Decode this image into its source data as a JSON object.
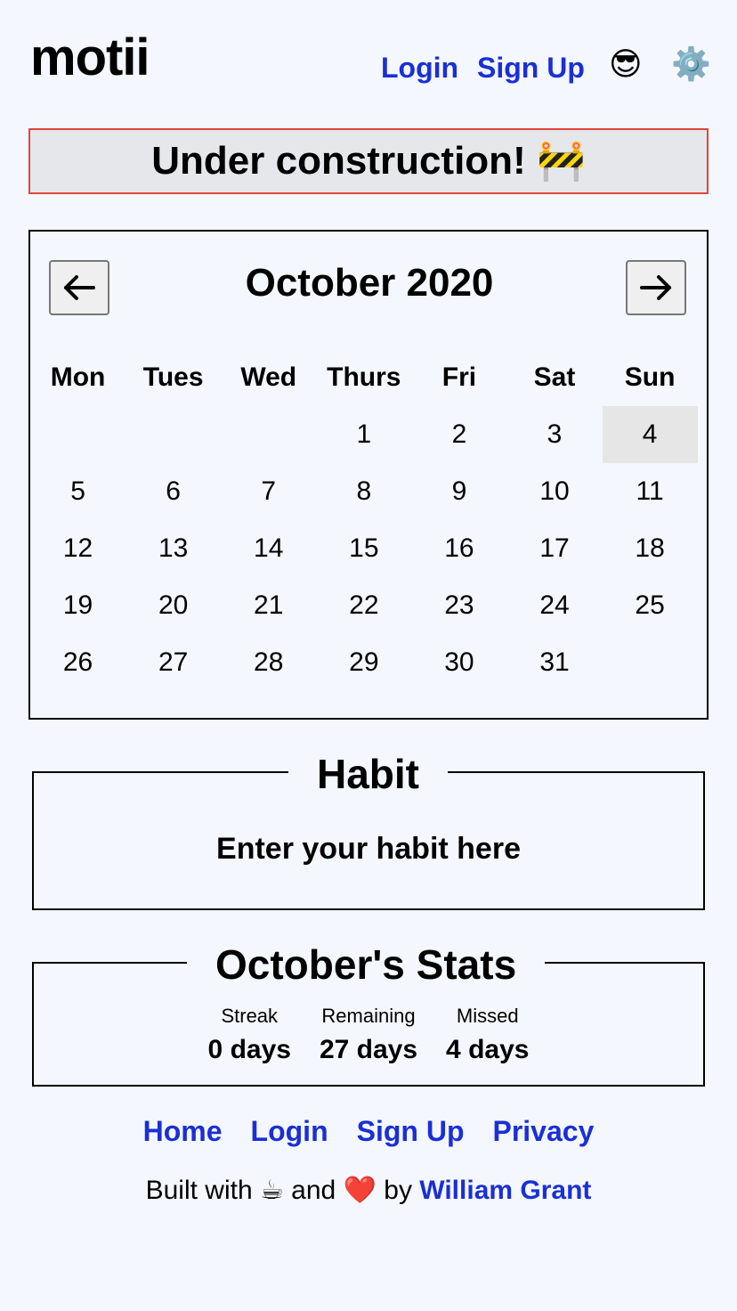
{
  "header": {
    "logo": "motii",
    "login_label": "Login",
    "signup_label": "Sign Up",
    "profile_emoji": "😎",
    "settings_emoji": "⚙️"
  },
  "banner": {
    "text": "Under construction! 🚧"
  },
  "calendar": {
    "month_label": "October 2020",
    "weekdays": [
      "Mon",
      "Tues",
      "Wed",
      "Thurs",
      "Fri",
      "Sat",
      "Sun"
    ],
    "weeks": [
      [
        "",
        "",
        "",
        "1",
        "2",
        "3",
        "4"
      ],
      [
        "5",
        "6",
        "7",
        "8",
        "9",
        "10",
        "11"
      ],
      [
        "12",
        "13",
        "14",
        "15",
        "16",
        "17",
        "18"
      ],
      [
        "19",
        "20",
        "21",
        "22",
        "23",
        "24",
        "25"
      ],
      [
        "26",
        "27",
        "28",
        "29",
        "30",
        "31",
        ""
      ]
    ],
    "today": "4",
    "highlight_color": "#e6e6e6"
  },
  "habit": {
    "legend": "Habit",
    "placeholder": "Enter your habit here"
  },
  "stats": {
    "legend": "October's Stats",
    "items": [
      {
        "label": "Streak",
        "value": "0 days"
      },
      {
        "label": "Remaining",
        "value": "27 days"
      },
      {
        "label": "Missed",
        "value": "4 days"
      }
    ]
  },
  "footer": {
    "links": [
      "Home",
      "Login",
      "Sign Up",
      "Privacy"
    ],
    "credit_prefix": "Built with ☕ and ❤️ by ",
    "credit_author": "William Grant"
  },
  "colors": {
    "link": "#1a2fd6",
    "banner_border": "#e0463a",
    "background": "#f4f7fd"
  }
}
